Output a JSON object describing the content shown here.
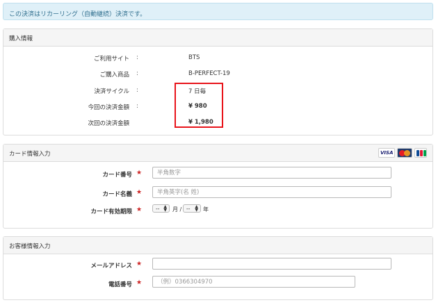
{
  "notice": {
    "text": "この決済はリカーリング（自動継続）決済です。"
  },
  "purchase": {
    "header": "購入情報",
    "rows": [
      {
        "label": "ご利用サイト",
        "colon": ":",
        "value": "BTS"
      },
      {
        "label": "ご購入商品",
        "colon": ":",
        "value": "B-PERFECT-19"
      },
      {
        "label": "決済サイクル",
        "colon": ":",
        "value": "7 日毎"
      },
      {
        "label": "今回の決済金額",
        "colon": ":",
        "value": "¥ 980"
      },
      {
        "label": "次回の決済金額",
        "colon": "",
        "value": "¥ 1,980"
      }
    ]
  },
  "card": {
    "header": "カード情報入力",
    "brands": [
      "VISA",
      "MasterCard",
      "JCB"
    ],
    "number": {
      "label": "カード番号",
      "required": "★",
      "placeholder": "半角数字",
      "value": ""
    },
    "name": {
      "label": "カード名義",
      "required": "★",
      "placeholder": "半角英字(名 姓)",
      "value": ""
    },
    "expiry": {
      "label": "カード有効期限",
      "required": "★",
      "month_value": "--",
      "month_unit": "月 /",
      "year_value": "--",
      "year_unit": "年"
    }
  },
  "customer": {
    "header": "お客様情報入力",
    "email": {
      "label": "メールアドレス",
      "required": "★",
      "placeholder": "",
      "value": ""
    },
    "phone": {
      "label": "電話番号",
      "required": "★",
      "placeholder": "（例）0366304970",
      "value": ""
    }
  },
  "colors": {
    "accent_red": "#e8131a",
    "notice_bg": "#dff0f8",
    "required_star": "#cc2222"
  }
}
